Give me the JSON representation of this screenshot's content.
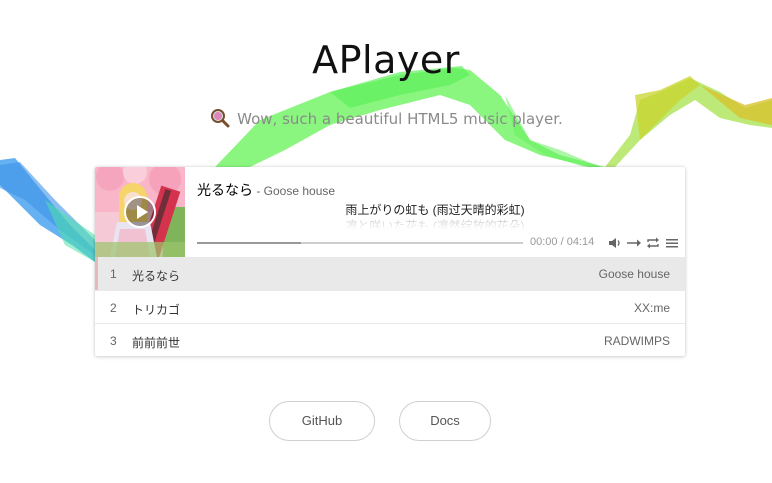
{
  "page": {
    "title": "APlayer",
    "tagline": "Wow, such a beautiful HTML5 music player."
  },
  "player": {
    "current": {
      "title": "光るなら",
      "author": " - Goose house"
    },
    "lyrics": {
      "current": "雨上がりの虹も (雨过天晴的彩虹)",
      "next": "凛と咲いた花も (凛然绽放的花朵)"
    },
    "progress": 0.32,
    "time": "00:00 / 04:14",
    "controls": [
      "volume-icon",
      "order-icon",
      "loop-icon",
      "menu-icon"
    ]
  },
  "playlist": [
    {
      "index": "1",
      "title": "光るなら",
      "artist": "Goose house",
      "active": true
    },
    {
      "index": "2",
      "title": "トリカゴ",
      "artist": "XX:me",
      "active": false
    },
    {
      "index": "3",
      "title": "前前前世",
      "artist": "RADWIMPS",
      "active": false
    }
  ],
  "links": {
    "github": "GitHub",
    "docs": "Docs"
  },
  "colors": {
    "ribbon_blue": "#4aa3f0",
    "ribbon_green": "#5ef05a",
    "ribbon_lime": "#a6e24a",
    "ribbon_yellow": "#d8c330",
    "active_row": "#e9e9e9",
    "active_marker": "#e6b9b9"
  }
}
